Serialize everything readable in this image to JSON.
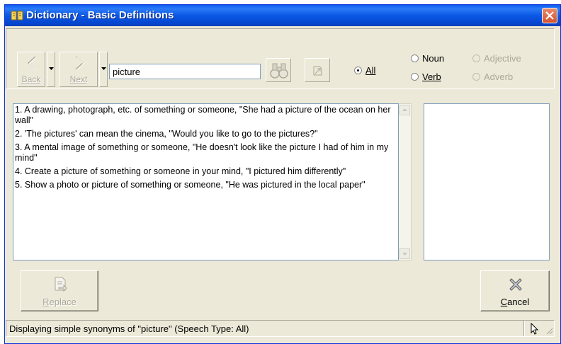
{
  "window": {
    "title": "Dictionary - Basic Definitions"
  },
  "toolbar": {
    "back_label": "Back",
    "next_label": "Next",
    "search_value": "picture"
  },
  "speech_type": {
    "options": [
      {
        "label": "All",
        "selected": true,
        "enabled": true
      },
      {
        "label": "Noun",
        "selected": false,
        "enabled": true
      },
      {
        "label": "Verb",
        "selected": false,
        "enabled": true
      },
      {
        "label": "Adjective",
        "selected": false,
        "enabled": false
      },
      {
        "label": "Adverb",
        "selected": false,
        "enabled": false
      }
    ]
  },
  "definitions": [
    "1. A drawing, photograph, etc. of something or someone, \"She had a picture of the ocean on her wall\"",
    "2. 'The pictures' can mean the cinema, \"Would you like to go to the pictures?\"",
    "3. A mental image of something or someone, \"He doesn't look like the picture I had of him in my mind\"",
    "4. Create a picture of something or someone in your mind, \"I pictured him differently\"",
    "5. Show a photo or picture of something or someone, \"He was pictured in the local paper\""
  ],
  "buttons": {
    "replace_label": "Replace",
    "cancel_label": "Cancel"
  },
  "status": {
    "text": "Displaying simple synonyms of \"picture\" (Speech Type: All)"
  },
  "colors": {
    "titlebar": "#0b58e5",
    "close": "#d35230",
    "face": "#ece9d8",
    "disabled_text": "#aca899"
  }
}
